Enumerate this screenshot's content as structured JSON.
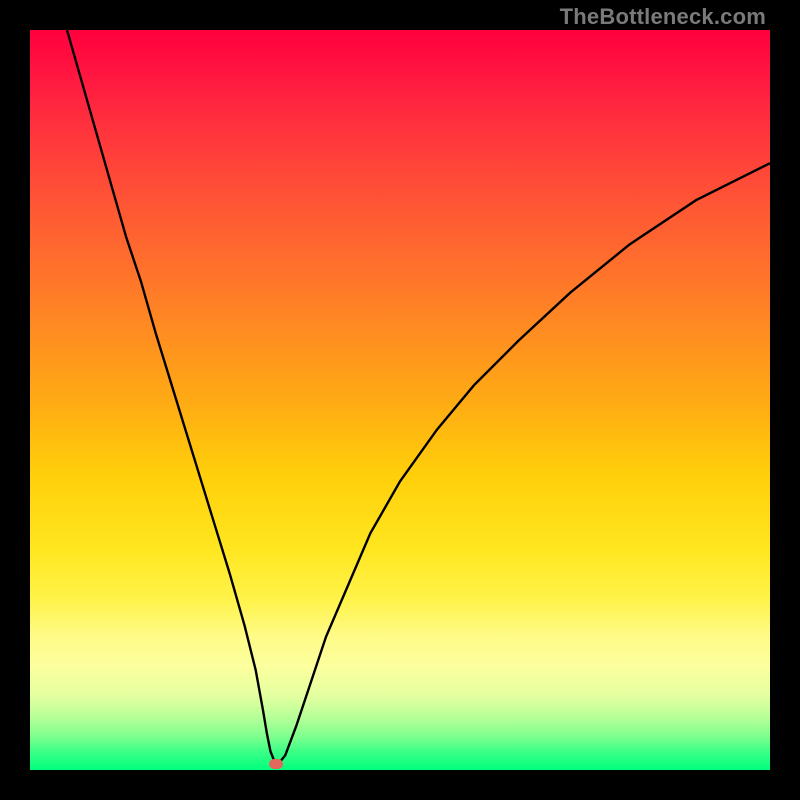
{
  "watermark": "TheBottleneck.com",
  "chart_data": {
    "type": "line",
    "title": "",
    "xlabel": "",
    "ylabel": "",
    "xlim": [
      0,
      100
    ],
    "ylim": [
      0,
      100
    ],
    "x": [
      5,
      7,
      9,
      11,
      13,
      15,
      17,
      19,
      21,
      23,
      25,
      27,
      29,
      30.5,
      31.5,
      32,
      32.5,
      33.3,
      34.5,
      36,
      38,
      40,
      43,
      46,
      50,
      55,
      60,
      66,
      73,
      81,
      90,
      100
    ],
    "values": [
      100,
      93,
      86,
      79,
      72,
      66,
      59,
      52.5,
      46,
      39.5,
      33,
      26.5,
      19.5,
      13.5,
      8,
      5,
      2.5,
      0.5,
      2,
      6,
      12,
      18,
      25,
      32,
      39,
      46,
      52,
      58,
      64.5,
      71,
      77,
      82
    ],
    "marker": {
      "x": 33.3,
      "y": 0.8
    },
    "gradient_stops": [
      {
        "pos": 0.0,
        "color": "#ff003d"
      },
      {
        "pos": 0.2,
        "color": "#ff4a38"
      },
      {
        "pos": 0.4,
        "color": "#ff8a22"
      },
      {
        "pos": 0.6,
        "color": "#ffcf0a"
      },
      {
        "pos": 0.8,
        "color": "#fffb88"
      },
      {
        "pos": 0.93,
        "color": "#b4ff98"
      },
      {
        "pos": 1.0,
        "color": "#00ff7e"
      }
    ]
  }
}
